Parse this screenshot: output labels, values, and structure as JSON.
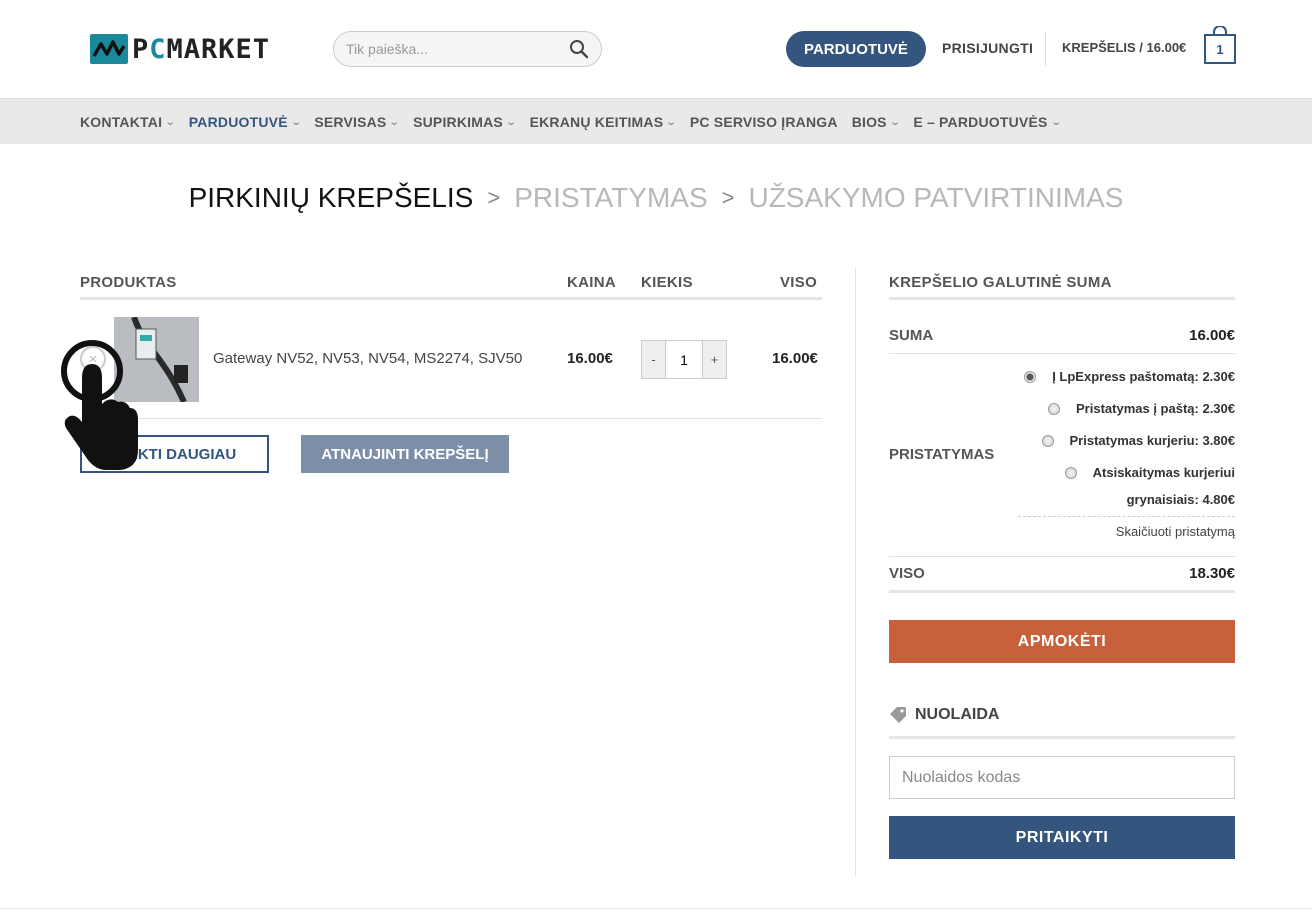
{
  "header": {
    "logo_prefix": "P",
    "logo_accent": "C",
    "logo_suffix": "MARKET",
    "search_placeholder": "Tik paieška...",
    "shop_button": "PARDUOTUVĖ",
    "login": "PRISIJUNGTI",
    "cart_label": "KREPŠELIS / 16.00€",
    "cart_count": "1"
  },
  "nav": {
    "items": [
      {
        "label": "KONTAKTAI",
        "dropdown": true
      },
      {
        "label": "PARDUOTUVĖ",
        "dropdown": true
      },
      {
        "label": "SERVISAS",
        "dropdown": true
      },
      {
        "label": "SUPIRKIMAS",
        "dropdown": true
      },
      {
        "label": "EKRANŲ KEITIMAS",
        "dropdown": true
      },
      {
        "label": "PC SERVISO ĮRANGA",
        "dropdown": false
      },
      {
        "label": "BIOS",
        "dropdown": true
      },
      {
        "label": "E – PARDUOTUVĖS",
        "dropdown": true
      }
    ]
  },
  "steps": {
    "current": "PIRKINIŲ KREPŠELIS",
    "next1": "PRISTATYMAS",
    "next2": "UŽSAKYMO PATVIRTINIMAS"
  },
  "cart": {
    "col_product": "PRODUKTAS",
    "col_price": "KAINA",
    "col_qty": "KIEKIS",
    "col_total": "VISO",
    "remove_symbol": "×",
    "item": {
      "name": "Gateway NV52, NV53, NV54, MS2274, SJV50",
      "price": "16.00€",
      "qty": "1",
      "qty_minus": "-",
      "qty_plus": "+",
      "total": "16.00€"
    },
    "continue_button": "PIRKTI DAUGIAU",
    "update_button": "ATNAUJINTI KREPŠELĮ"
  },
  "totals": {
    "heading": "KREPŠELIO GALUTINĖ SUMA",
    "subtotal_label": "SUMA",
    "subtotal_value": "16.00€",
    "shipping_label": "PRISTATYMAS",
    "shipping_options": [
      {
        "label": "Į LpExpress paštomatą: 2.30€",
        "selected": true
      },
      {
        "label": "Pristatymas į paštą: 2.30€",
        "selected": false
      },
      {
        "label": "Pristatymas kurjeriu: 3.80€",
        "selected": false
      },
      {
        "label": "Atsiskaitymas kurjeriui",
        "selected": false
      }
    ],
    "shipping_option4_line2": "grynaisiais: 4.80€",
    "calc_shipping": "Skaičiuoti pristatymą",
    "total_label": "VISO",
    "total_value": "18.30€",
    "checkout_button": "APMOKĖTI"
  },
  "coupon": {
    "heading": "NUOLAIDA",
    "placeholder": "Nuolaidos kodas",
    "apply_button": "PRITAIKYTI"
  },
  "colors": {
    "primary": "#34557e",
    "checkout": "#c8603a",
    "logo": "#1a8a9a"
  }
}
